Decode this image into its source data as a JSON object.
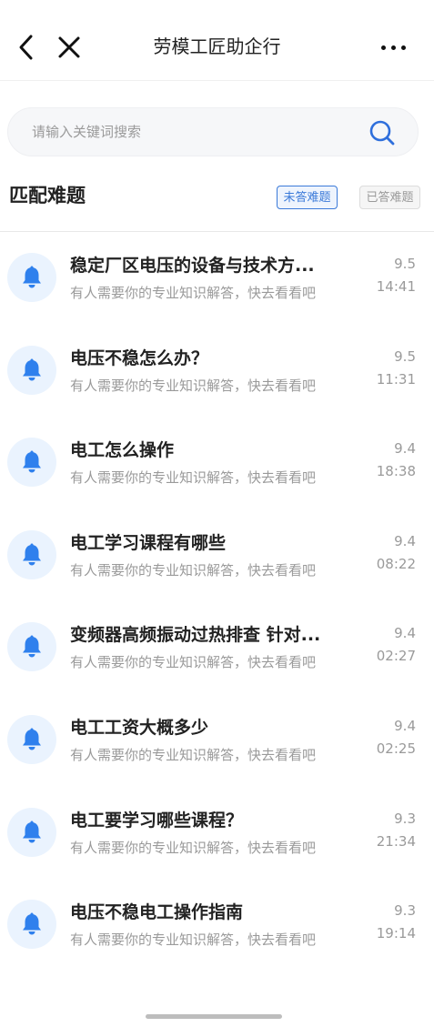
{
  "header": {
    "title": "劳模工匠助企行"
  },
  "search": {
    "placeholder": "请输入关键词搜索"
  },
  "section": {
    "title": "匹配难题",
    "tab_unanswered": "未答难题",
    "tab_answered": "已答难题"
  },
  "colors": {
    "accent": "#3b7ad9",
    "bell": "#2f80ed",
    "bell_bg": "#eaf3fe"
  },
  "items": [
    {
      "title": "稳定厂区电压的设备与技术方...",
      "subtitle": "有人需要你的专业知识解答，快去看看吧",
      "date": "9.5",
      "time": "14:41",
      "icon": "bell-icon"
    },
    {
      "title": "电压不稳怎么办？",
      "subtitle": "有人需要你的专业知识解答，快去看看吧",
      "date": "9.5",
      "time": "11:31",
      "icon": "bell-icon"
    },
    {
      "title": "电工怎么操作",
      "subtitle": "有人需要你的专业知识解答，快去看看吧",
      "date": "9.4",
      "time": "18:38",
      "icon": "bell-icon"
    },
    {
      "title": "电工学习课程有哪些",
      "subtitle": "有人需要你的专业知识解答，快去看看吧",
      "date": "9.4",
      "time": "08:22",
      "icon": "bell-icon"
    },
    {
      "title": "变频器高频振动过热排查 针对...",
      "subtitle": "有人需要你的专业知识解答，快去看看吧",
      "date": "9.4",
      "time": "02:27",
      "icon": "bell-icon"
    },
    {
      "title": "电工工资大概多少",
      "subtitle": "有人需要你的专业知识解答，快去看看吧",
      "date": "9.4",
      "time": "02:25",
      "icon": "bell-icon"
    },
    {
      "title": "电工要学习哪些课程？",
      "subtitle": "有人需要你的专业知识解答，快去看看吧",
      "date": "9.3",
      "time": "21:34",
      "icon": "bell-icon"
    },
    {
      "title": "电压不稳电工操作指南",
      "subtitle": "有人需要你的专业知识解答，快去看看吧",
      "date": "9.3",
      "time": "19:14",
      "icon": "bell-icon"
    }
  ]
}
